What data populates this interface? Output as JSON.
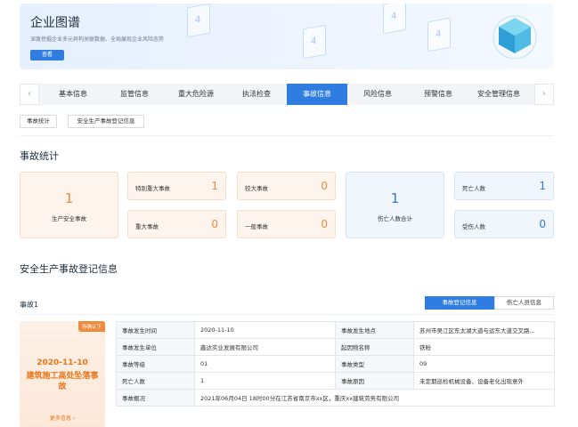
{
  "banner": {
    "title": "企业图谱",
    "subtitle": "深度挖掘企业多元异构关联数据、全局展现企业风险态势",
    "button": "查看"
  },
  "tabs": [
    "基本信息",
    "监管信息",
    "重大危险源",
    "执法检查",
    "事故信息",
    "风险信息",
    "预警信息",
    "安全管理信息"
  ],
  "active_tab": "事故信息",
  "subtabs": [
    "事故统计",
    "安全生产事故登记信息"
  ],
  "stats": {
    "title": "事故统计",
    "total": {
      "value": "1",
      "label": "生产安全事故"
    },
    "items": [
      {
        "label": "特别重大事故",
        "value": "1"
      },
      {
        "label": "较大事故",
        "value": "0"
      },
      {
        "label": "重大事故",
        "value": "0"
      },
      {
        "label": "一般事故",
        "value": "0"
      }
    ],
    "casualty_total": {
      "value": "1",
      "label": "伤亡人数合计"
    },
    "casualties": [
      {
        "label": "死亡人数",
        "value": "1"
      },
      {
        "label": "受伤人数",
        "value": "0"
      }
    ]
  },
  "registry": {
    "title": "安全生产事故登记信息",
    "accident_label": "事故1",
    "toggle_on": "事故登记信息",
    "toggle_off": "伤亡人员信息",
    "card": {
      "badge": "待确认下",
      "date": "2020-11-10",
      "name": "建筑施工高处坠落事故",
      "more": "更多信息 ›"
    },
    "rows": [
      [
        "事故发生时间",
        "2020-11-10",
        "事故发生地点",
        "苏州市吴江区东太湖大道与运东大道交叉路..."
      ],
      [
        "事故发生单位",
        "鑫达实业发展有限公司",
        "起因物名称",
        "铁粉"
      ],
      [
        "事故等级",
        "01",
        "事故类型",
        "09"
      ],
      [
        "死亡人数",
        "1",
        "事故原因",
        "未定期巡检机械设备、设备老化出现意外"
      ]
    ],
    "summary": [
      "事故概况",
      "2021年06月04日 18时00分在江苏省南京市xx区，重庆xx建筑劳务有限公司"
    ]
  },
  "colors": {
    "accent": "#2f7de1",
    "orange": "#f08b3d",
    "blue": "#3477d3"
  }
}
